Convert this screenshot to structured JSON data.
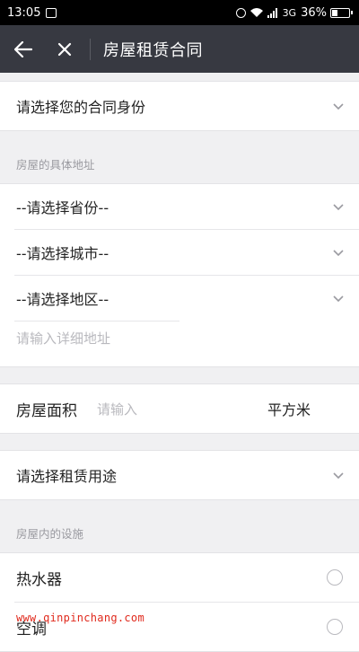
{
  "status": {
    "time": "13:05",
    "network": "3G",
    "battery": "36%",
    "battery_level": 0.36
  },
  "nav": {
    "title": "房屋租赁合同"
  },
  "identity": {
    "label": "请选择您的合同身份"
  },
  "address": {
    "section_label": "房屋的具体地址",
    "province": "--请选择省份--",
    "city": "--请选择城市--",
    "district": "--请选择地区--",
    "detail_placeholder": "请输入详细地址"
  },
  "area": {
    "label": "房屋面积",
    "placeholder": "请输入",
    "unit": "平方米"
  },
  "usage": {
    "label": "请选择租赁用途"
  },
  "facilities": {
    "section_label": "房屋内的设施",
    "items": [
      {
        "label": "热水器"
      },
      {
        "label": "空调"
      }
    ]
  },
  "watermark": "www.qinpinchang.com",
  "colors": {
    "nav_bg": "#373941",
    "page_bg": "#f0f0f2",
    "watermark": "#e0291c"
  }
}
